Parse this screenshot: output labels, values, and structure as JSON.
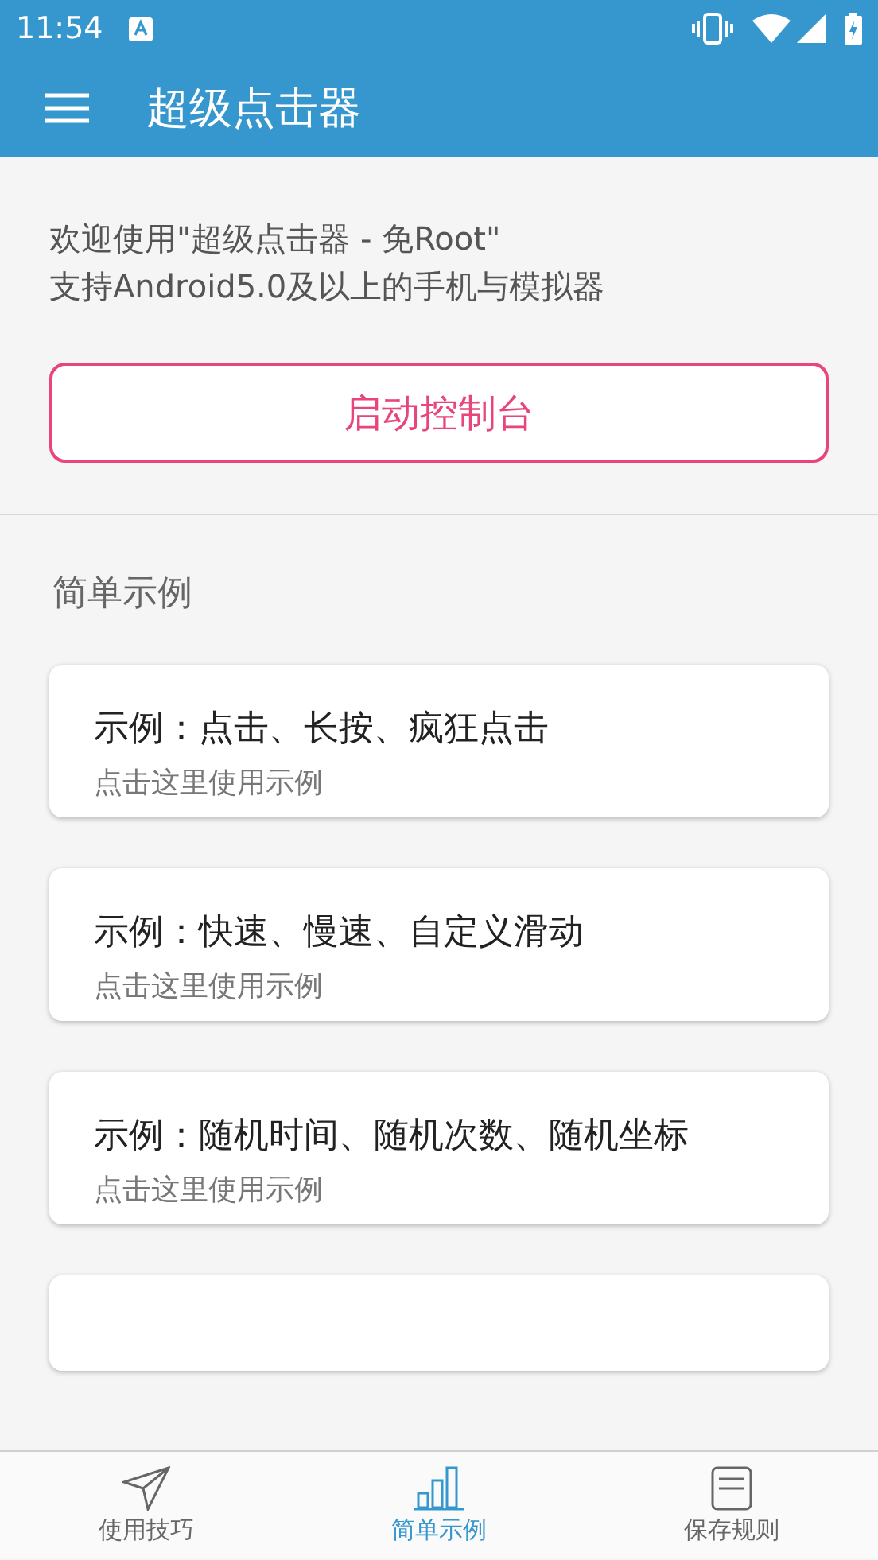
{
  "status_bar": {
    "time": "11:54"
  },
  "app_bar": {
    "title": "超级点击器"
  },
  "intro": {
    "lines": [
      "欢迎使用\"超级点击器 - 免Root\"",
      "支持Android5.0及以上的手机与模拟器"
    ],
    "button": "启动控制台"
  },
  "section": {
    "title": "简单示例"
  },
  "examples": [
    {
      "title": "示例：点击、长按、疯狂点击",
      "subtitle": "点击这里使用示例"
    },
    {
      "title": "示例：快速、慢速、自定义滑动",
      "subtitle": "点击这里使用示例"
    },
    {
      "title": "示例：随机时间、随机次数、随机坐标",
      "subtitle": "点击这里使用示例"
    },
    {
      "kind": "partial"
    }
  ],
  "bottom_nav": [
    {
      "label": "使用技巧",
      "kind": "send",
      "selected": false
    },
    {
      "label": "简单示例",
      "kind": "chart",
      "selected": true
    },
    {
      "label": "保存规则",
      "kind": "doc",
      "selected": false
    }
  ]
}
